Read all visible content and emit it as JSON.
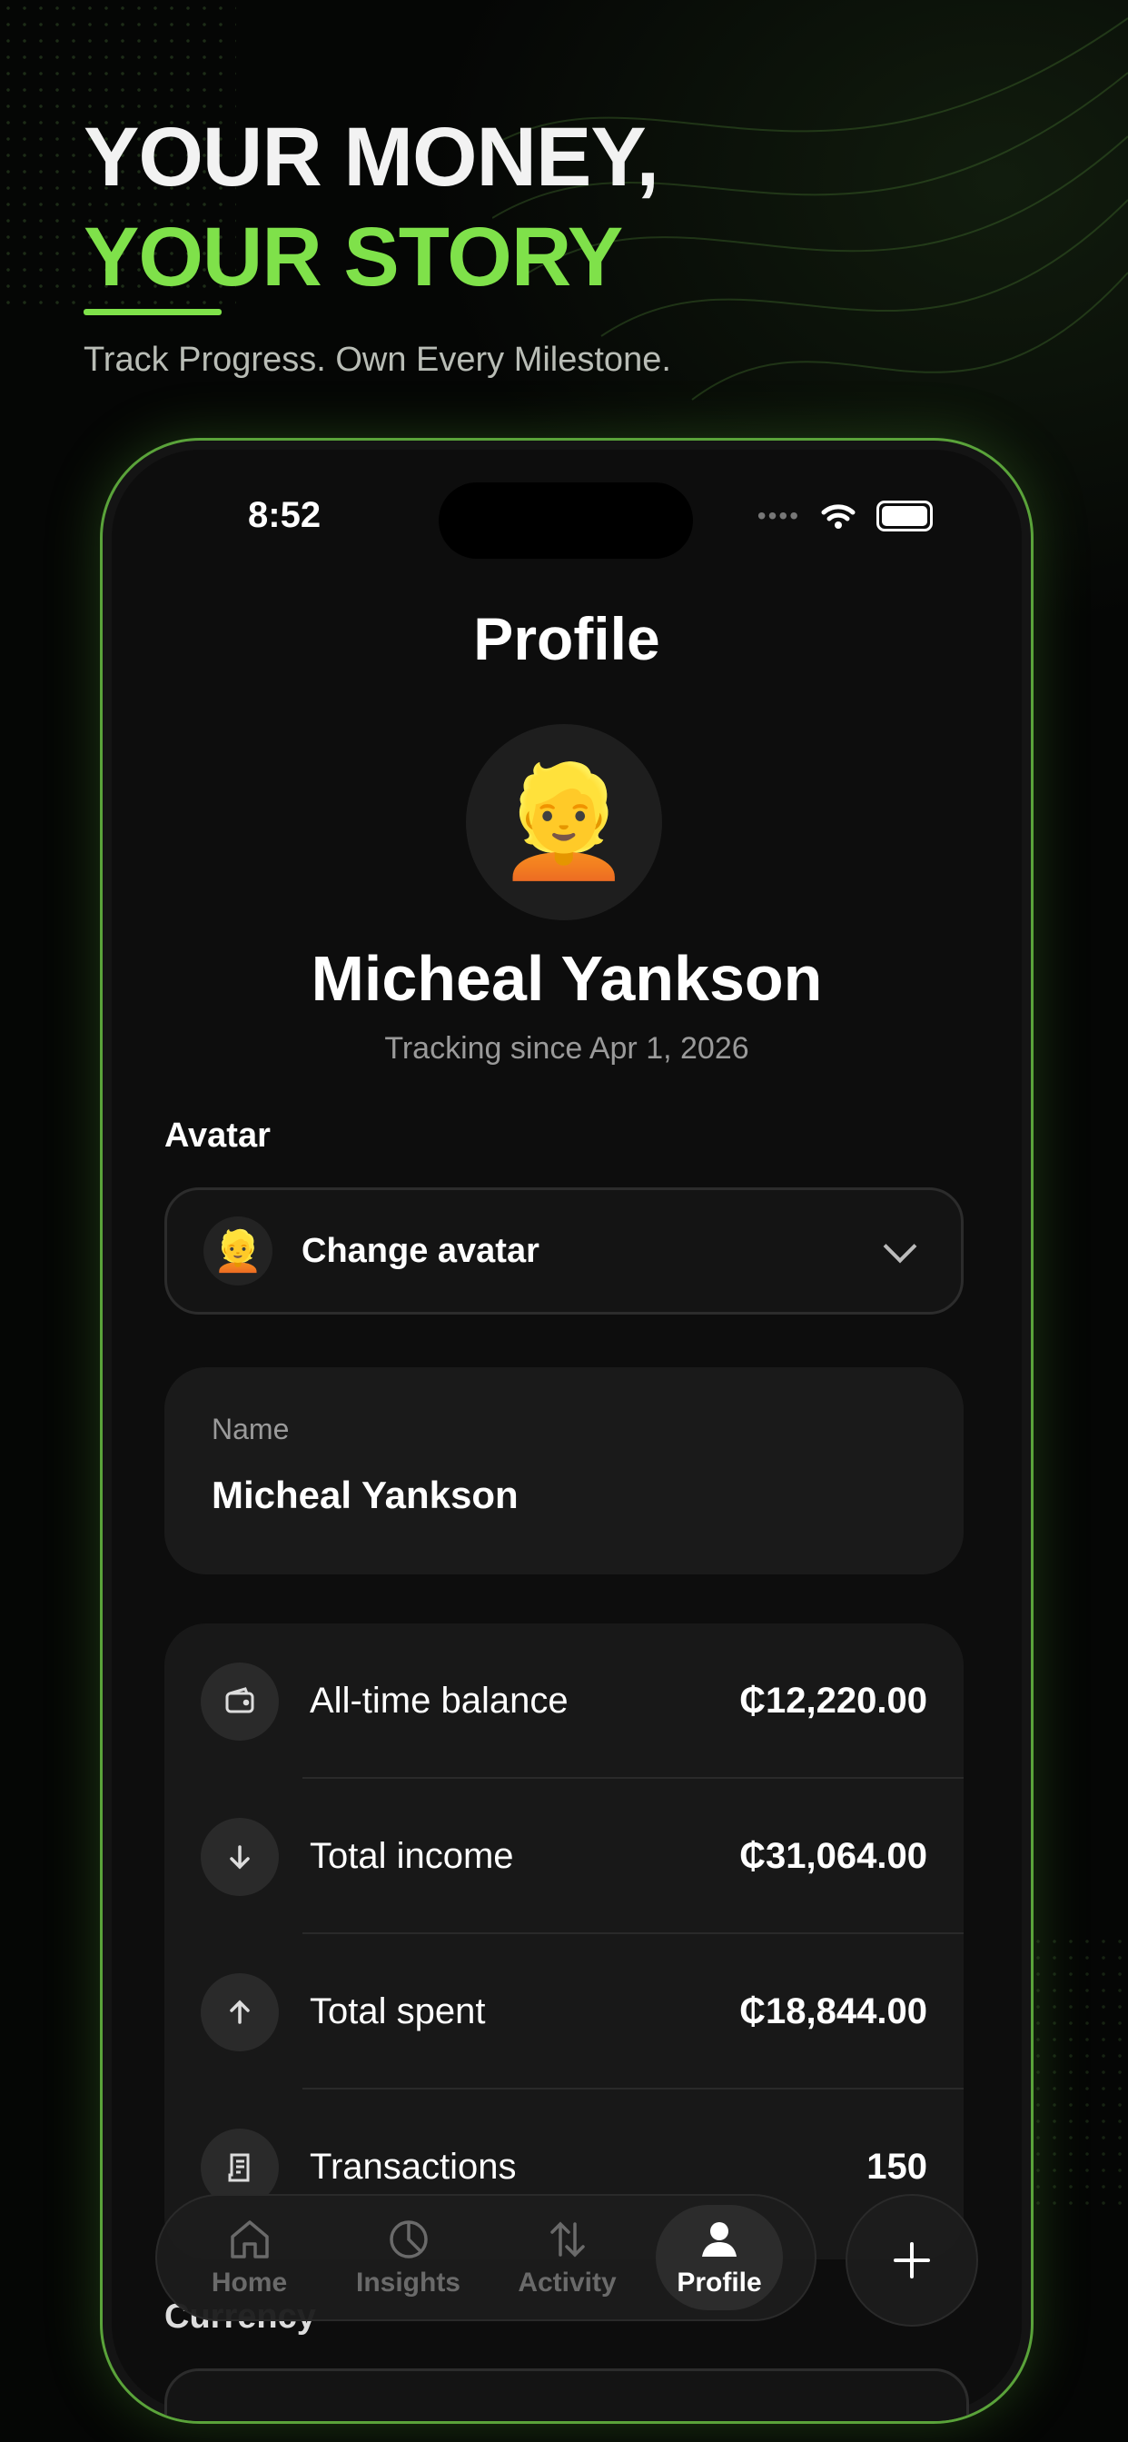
{
  "hero": {
    "line1": "YOUR MONEY,",
    "line2": "YOUR STORY",
    "tagline": "Track Progress. Own Every Milestone."
  },
  "status_bar": {
    "time": "8:52"
  },
  "profile": {
    "title": "Profile",
    "avatar_emoji": "👱",
    "name": "Micheal Yankson",
    "since": "Tracking since Apr 1, 2026"
  },
  "avatar_section": {
    "label": "Avatar",
    "change_label": "Change avatar",
    "avatar_emoji": "👱"
  },
  "name_card": {
    "caption": "Name",
    "value": "Micheal Yankson"
  },
  "stats": [
    {
      "label": "All-time balance",
      "value": "₵12,220.00",
      "icon": "wallet-icon"
    },
    {
      "label": "Total income",
      "value": "₵31,064.00",
      "icon": "arrow-down-icon"
    },
    {
      "label": "Total spent",
      "value": "₵18,844.00",
      "icon": "arrow-up-icon"
    },
    {
      "label": "Transactions",
      "value": "150",
      "icon": "receipt-icon"
    }
  ],
  "currency_label": "Currency",
  "tabs": [
    {
      "label": "Home",
      "icon": "home-icon"
    },
    {
      "label": "Insights",
      "icon": "pie-chart-icon"
    },
    {
      "label": "Activity",
      "icon": "transfer-arrows-icon"
    },
    {
      "label": "Profile",
      "icon": "person-icon",
      "active": true
    }
  ],
  "colors": {
    "accent": "#7fe14a",
    "card": "#1a1a1a",
    "background": "#0d0d0d"
  }
}
